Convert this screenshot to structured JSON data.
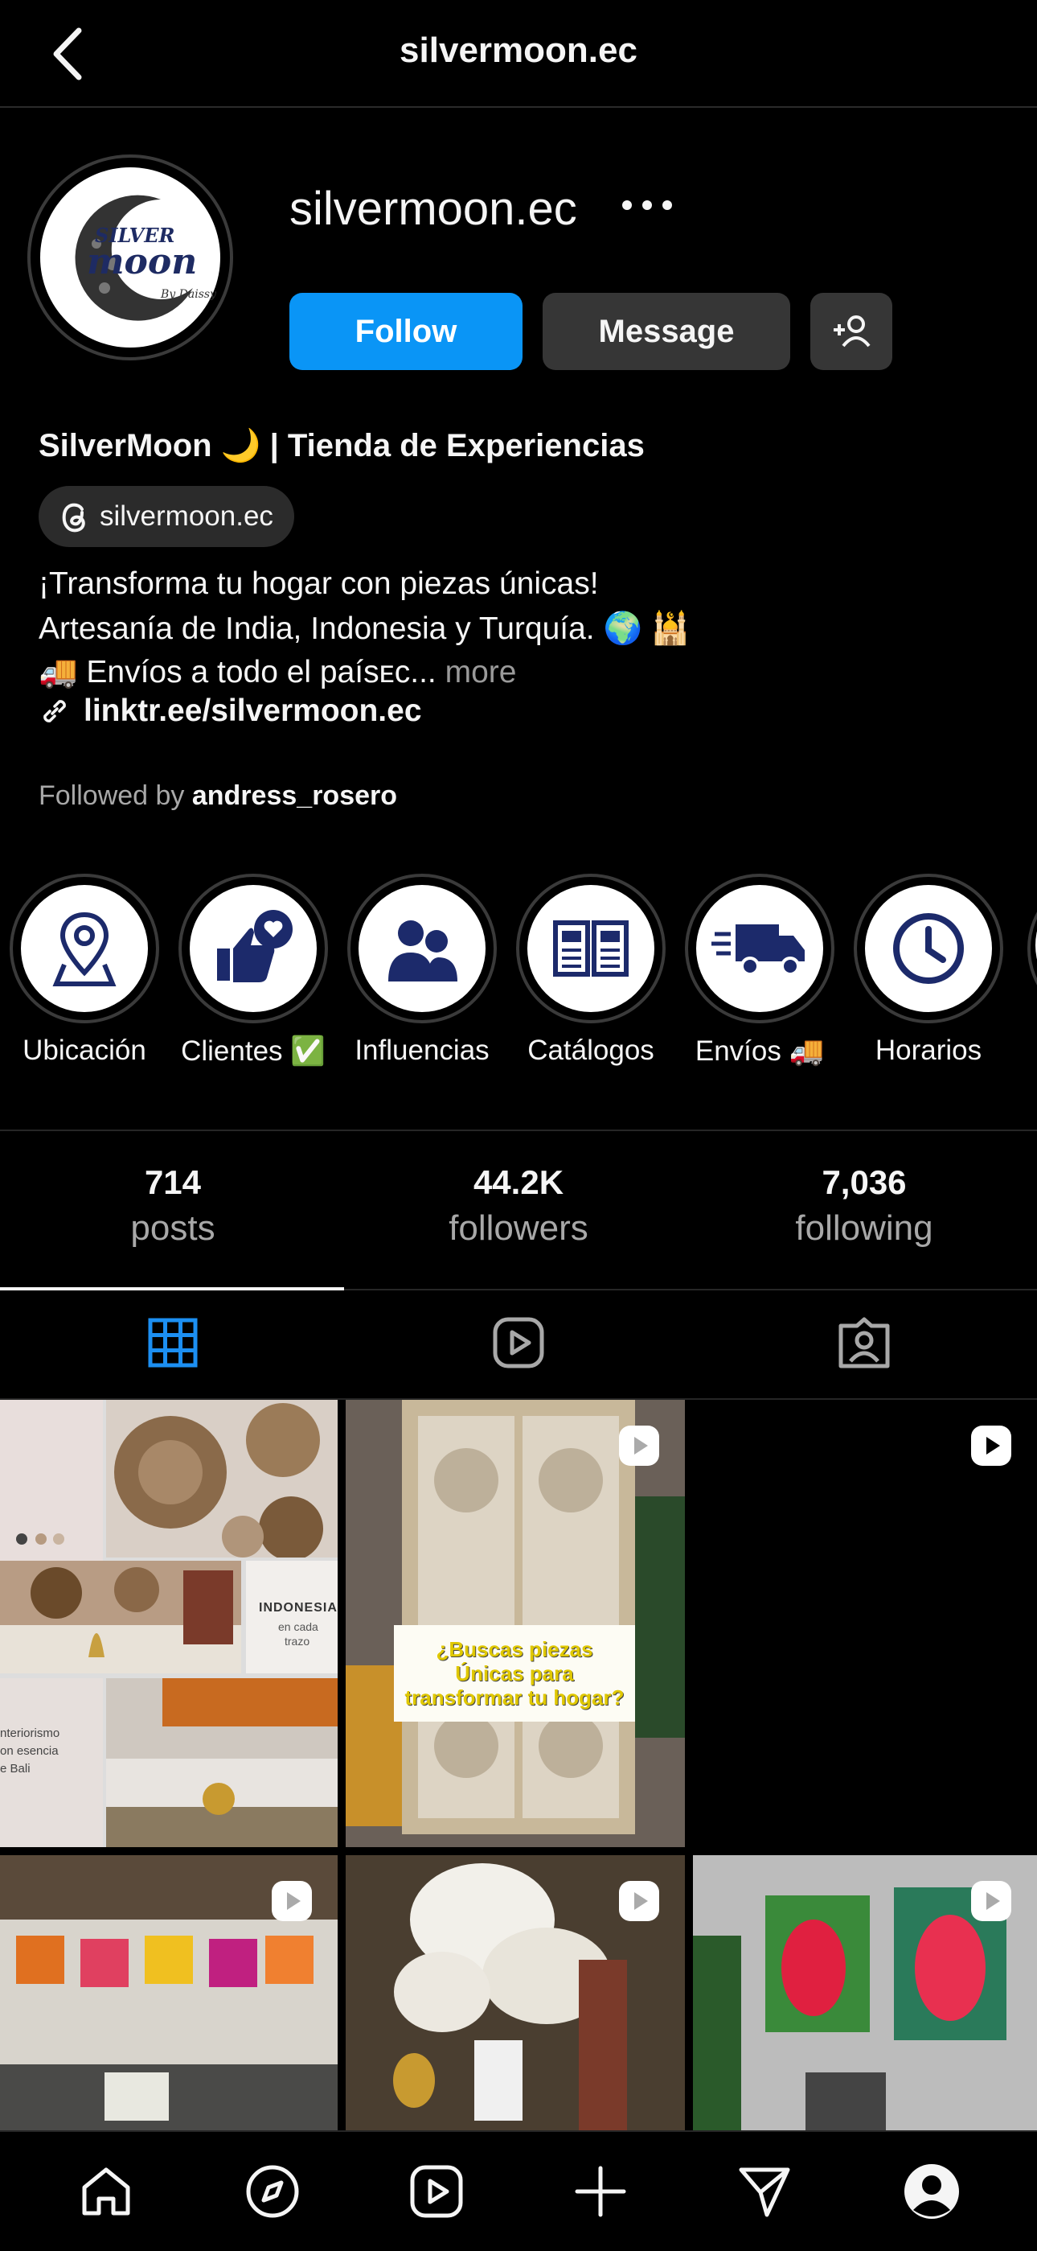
{
  "topbar": {
    "title": "silvermoon.ec"
  },
  "profile": {
    "username": "silvermoon.ec",
    "avatar_text_top": "SILVER",
    "avatar_text_main": "moon",
    "avatar_text_sub": "By Daissy",
    "follow_label": "Follow",
    "message_label": "Message"
  },
  "bio": {
    "display_name": "SilverMoon 🌙 | Tienda de Experiencias",
    "threads_handle": "silvermoon.ec",
    "line1": "¡Transforma tu hogar con piezas únicas!",
    "line2": "Artesanía de India, Indonesia y Turquía. 🌍 🕌",
    "line3": "🚚 Envíos a todo el paísᴇᴄ...",
    "more": "more",
    "link": "linktr.ee/silvermoon.ec",
    "followed_by_prefix": "Followed by",
    "followed_by_user": "andress_rosero"
  },
  "highlights": [
    {
      "label": "Ubicación",
      "icon": "location-pin-icon"
    },
    {
      "label": "Clientes ✅",
      "icon": "thumbs-up-heart-icon"
    },
    {
      "label": "Influencias",
      "icon": "people-icon"
    },
    {
      "label": "Catálogos",
      "icon": "catalog-book-icon"
    },
    {
      "label": "Envíos 🚚",
      "icon": "delivery-truck-icon"
    },
    {
      "label": "Horarios",
      "icon": "clock-icon"
    }
  ],
  "stats": {
    "posts_count": "714",
    "posts_label": "posts",
    "followers_count": "44.2K",
    "followers_label": "followers",
    "following_count": "7,036",
    "following_label": "following"
  },
  "tabs": [
    {
      "name": "grid",
      "icon": "grid-icon",
      "active": true
    },
    {
      "name": "reels",
      "icon": "reels-icon",
      "active": false
    },
    {
      "name": "tagged",
      "icon": "tagged-icon",
      "active": false
    }
  ],
  "posts": {
    "post1_tag": "INDONESIA",
    "post1_tag_sub1": "en cada",
    "post1_tag_sub2": "trazo",
    "post1_text1": "nteriorismo",
    "post1_text2": "on esencia",
    "post1_text3": "e Bali",
    "post2_caption": "¿Buscas piezas Únicas para transformar tu hogar?"
  },
  "bottom_nav": [
    "home-icon",
    "explore-icon",
    "reels-icon",
    "create-icon",
    "direct-icon",
    "profile-icon"
  ],
  "colors": {
    "accent": "#0a95f6",
    "highlight_icon": "#1c2a6b",
    "background": "#000000"
  }
}
